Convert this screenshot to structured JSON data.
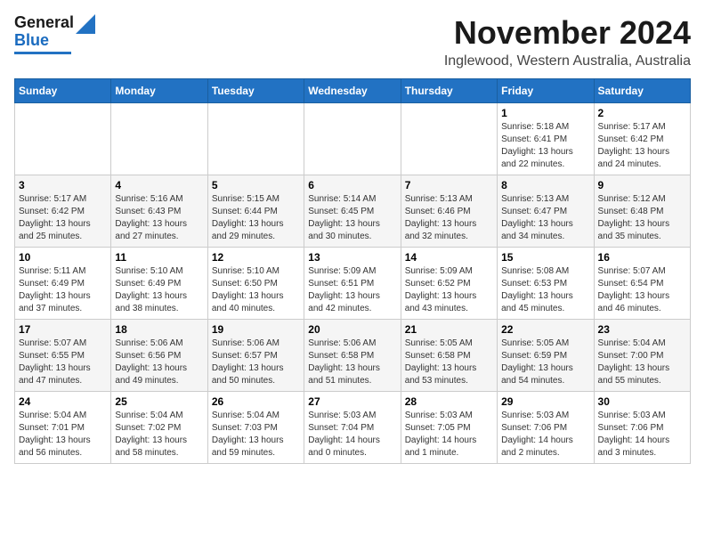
{
  "header": {
    "logo_line1": "General",
    "logo_line2": "Blue",
    "main_title": "November 2024",
    "subtitle": "Inglewood, Western Australia, Australia"
  },
  "calendar": {
    "days_of_week": [
      "Sunday",
      "Monday",
      "Tuesday",
      "Wednesday",
      "Thursday",
      "Friday",
      "Saturday"
    ],
    "weeks": [
      [
        {
          "day": "",
          "info": ""
        },
        {
          "day": "",
          "info": ""
        },
        {
          "day": "",
          "info": ""
        },
        {
          "day": "",
          "info": ""
        },
        {
          "day": "",
          "info": ""
        },
        {
          "day": "1",
          "info": "Sunrise: 5:18 AM\nSunset: 6:41 PM\nDaylight: 13 hours\nand 22 minutes."
        },
        {
          "day": "2",
          "info": "Sunrise: 5:17 AM\nSunset: 6:42 PM\nDaylight: 13 hours\nand 24 minutes."
        }
      ],
      [
        {
          "day": "3",
          "info": "Sunrise: 5:17 AM\nSunset: 6:42 PM\nDaylight: 13 hours\nand 25 minutes."
        },
        {
          "day": "4",
          "info": "Sunrise: 5:16 AM\nSunset: 6:43 PM\nDaylight: 13 hours\nand 27 minutes."
        },
        {
          "day": "5",
          "info": "Sunrise: 5:15 AM\nSunset: 6:44 PM\nDaylight: 13 hours\nand 29 minutes."
        },
        {
          "day": "6",
          "info": "Sunrise: 5:14 AM\nSunset: 6:45 PM\nDaylight: 13 hours\nand 30 minutes."
        },
        {
          "day": "7",
          "info": "Sunrise: 5:13 AM\nSunset: 6:46 PM\nDaylight: 13 hours\nand 32 minutes."
        },
        {
          "day": "8",
          "info": "Sunrise: 5:13 AM\nSunset: 6:47 PM\nDaylight: 13 hours\nand 34 minutes."
        },
        {
          "day": "9",
          "info": "Sunrise: 5:12 AM\nSunset: 6:48 PM\nDaylight: 13 hours\nand 35 minutes."
        }
      ],
      [
        {
          "day": "10",
          "info": "Sunrise: 5:11 AM\nSunset: 6:49 PM\nDaylight: 13 hours\nand 37 minutes."
        },
        {
          "day": "11",
          "info": "Sunrise: 5:10 AM\nSunset: 6:49 PM\nDaylight: 13 hours\nand 38 minutes."
        },
        {
          "day": "12",
          "info": "Sunrise: 5:10 AM\nSunset: 6:50 PM\nDaylight: 13 hours\nand 40 minutes."
        },
        {
          "day": "13",
          "info": "Sunrise: 5:09 AM\nSunset: 6:51 PM\nDaylight: 13 hours\nand 42 minutes."
        },
        {
          "day": "14",
          "info": "Sunrise: 5:09 AM\nSunset: 6:52 PM\nDaylight: 13 hours\nand 43 minutes."
        },
        {
          "day": "15",
          "info": "Sunrise: 5:08 AM\nSunset: 6:53 PM\nDaylight: 13 hours\nand 45 minutes."
        },
        {
          "day": "16",
          "info": "Sunrise: 5:07 AM\nSunset: 6:54 PM\nDaylight: 13 hours\nand 46 minutes."
        }
      ],
      [
        {
          "day": "17",
          "info": "Sunrise: 5:07 AM\nSunset: 6:55 PM\nDaylight: 13 hours\nand 47 minutes."
        },
        {
          "day": "18",
          "info": "Sunrise: 5:06 AM\nSunset: 6:56 PM\nDaylight: 13 hours\nand 49 minutes."
        },
        {
          "day": "19",
          "info": "Sunrise: 5:06 AM\nSunset: 6:57 PM\nDaylight: 13 hours\nand 50 minutes."
        },
        {
          "day": "20",
          "info": "Sunrise: 5:06 AM\nSunset: 6:58 PM\nDaylight: 13 hours\nand 51 minutes."
        },
        {
          "day": "21",
          "info": "Sunrise: 5:05 AM\nSunset: 6:58 PM\nDaylight: 13 hours\nand 53 minutes."
        },
        {
          "day": "22",
          "info": "Sunrise: 5:05 AM\nSunset: 6:59 PM\nDaylight: 13 hours\nand 54 minutes."
        },
        {
          "day": "23",
          "info": "Sunrise: 5:04 AM\nSunset: 7:00 PM\nDaylight: 13 hours\nand 55 minutes."
        }
      ],
      [
        {
          "day": "24",
          "info": "Sunrise: 5:04 AM\nSunset: 7:01 PM\nDaylight: 13 hours\nand 56 minutes."
        },
        {
          "day": "25",
          "info": "Sunrise: 5:04 AM\nSunset: 7:02 PM\nDaylight: 13 hours\nand 58 minutes."
        },
        {
          "day": "26",
          "info": "Sunrise: 5:04 AM\nSunset: 7:03 PM\nDaylight: 13 hours\nand 59 minutes."
        },
        {
          "day": "27",
          "info": "Sunrise: 5:03 AM\nSunset: 7:04 PM\nDaylight: 14 hours\nand 0 minutes."
        },
        {
          "day": "28",
          "info": "Sunrise: 5:03 AM\nSunset: 7:05 PM\nDaylight: 14 hours\nand 1 minute."
        },
        {
          "day": "29",
          "info": "Sunrise: 5:03 AM\nSunset: 7:06 PM\nDaylight: 14 hours\nand 2 minutes."
        },
        {
          "day": "30",
          "info": "Sunrise: 5:03 AM\nSunset: 7:06 PM\nDaylight: 14 hours\nand 3 minutes."
        }
      ]
    ]
  }
}
